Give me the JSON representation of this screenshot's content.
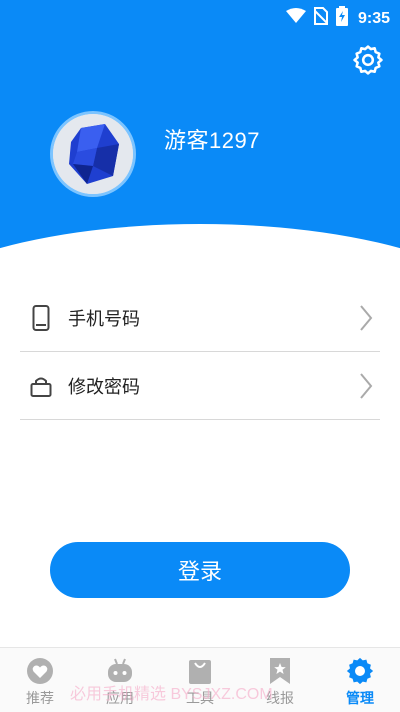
{
  "status_bar": {
    "time": "9:35",
    "icons": [
      "wifi-icon",
      "no-sim-icon",
      "battery-charging-icon"
    ]
  },
  "header": {
    "settings_icon": "gear-icon",
    "username": "游客1297",
    "colors": {
      "primary": "#0a8af7"
    }
  },
  "menu": {
    "items": [
      {
        "label": "手机号码",
        "icon": "phone-icon"
      },
      {
        "label": "修改密码",
        "icon": "lock-icon"
      }
    ]
  },
  "login_button": {
    "label": "登录"
  },
  "tabbar": {
    "tabs": [
      {
        "label": "推荐",
        "icon": "heart-icon",
        "active": false
      },
      {
        "label": "应用",
        "icon": "robot-icon",
        "active": false
      },
      {
        "label": "工具",
        "icon": "bag-icon",
        "active": false
      },
      {
        "label": "线报",
        "icon": "bookmark-star-icon",
        "active": false
      },
      {
        "label": "管理",
        "icon": "gear-icon",
        "active": true
      }
    ]
  },
  "watermark": "必用手机精选 BYSJXZ.COM"
}
